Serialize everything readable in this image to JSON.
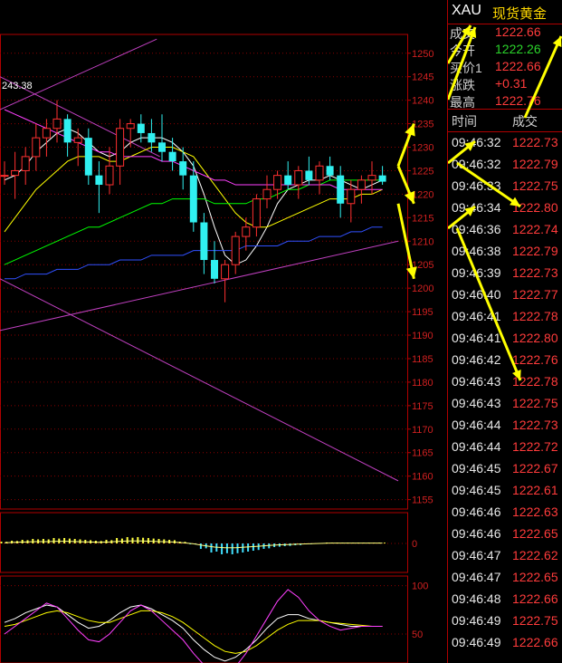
{
  "chart_data": [
    {
      "type": "candlestick",
      "price_labels": [
        "1250",
        "1245",
        "1240",
        "1235",
        "1230",
        "1225",
        "1220",
        "1215",
        "1210",
        "1205",
        "1200",
        "1195",
        "1190",
        "1185",
        "1180",
        "1175",
        "1170",
        "1165",
        "1160",
        "1155"
      ],
      "ylim": [
        1153,
        1254
      ],
      "annotation": "243.38",
      "ohlc": [
        [
          1224,
          1227,
          1222,
          1224
        ],
        [
          1224,
          1229,
          1219,
          1225
        ],
        [
          1225,
          1230,
          1222,
          1228
        ],
        [
          1228,
          1235,
          1225,
          1232
        ],
        [
          1232,
          1236,
          1228,
          1234
        ],
        [
          1234,
          1240,
          1231,
          1236
        ],
        [
          1236,
          1237,
          1228,
          1231
        ],
        [
          1231,
          1234,
          1226,
          1232
        ],
        [
          1232,
          1234,
          1222,
          1224
        ],
        [
          1224,
          1227,
          1216,
          1222
        ],
        [
          1222,
          1230,
          1220,
          1226
        ],
        [
          1226,
          1236,
          1222,
          1234
        ],
        [
          1234,
          1236,
          1230,
          1235
        ],
        [
          1235,
          1237,
          1231,
          1233
        ],
        [
          1233,
          1236,
          1229,
          1231
        ],
        [
          1231,
          1237,
          1227,
          1229
        ],
        [
          1229,
          1232,
          1225,
          1227
        ],
        [
          1227,
          1230,
          1221,
          1224
        ],
        [
          1224,
          1227,
          1212,
          1214
        ],
        [
          1214,
          1216,
          1203,
          1206
        ],
        [
          1206,
          1210,
          1201,
          1202
        ],
        [
          1202,
          1206,
          1197,
          1205
        ],
        [
          1205,
          1212,
          1203,
          1211
        ],
        [
          1211,
          1215,
          1208,
          1213
        ],
        [
          1213,
          1220,
          1211,
          1219
        ],
        [
          1219,
          1224,
          1217,
          1221
        ],
        [
          1221,
          1225,
          1219,
          1224
        ],
        [
          1224,
          1227,
          1221,
          1222
        ],
        [
          1222,
          1226,
          1219,
          1225
        ],
        [
          1225,
          1228,
          1222,
          1223
        ],
        [
          1223,
          1227,
          1220,
          1226
        ],
        [
          1226,
          1228,
          1223,
          1224
        ],
        [
          1224,
          1226,
          1215,
          1218
        ],
        [
          1218,
          1223,
          1214,
          1221
        ],
        [
          1221,
          1224,
          1218,
          1223
        ],
        [
          1223,
          1227,
          1220,
          1224
        ],
        [
          1224,
          1226,
          1222,
          1222.66
        ]
      ],
      "ma": [
        {
          "color": "#ffffff",
          "values": [
            1223,
            1224,
            1226,
            1229,
            1231,
            1233,
            1234,
            1233,
            1231,
            1229,
            1228,
            1229,
            1231,
            1232,
            1232,
            1232,
            1231,
            1229,
            1226,
            1220,
            1213,
            1207,
            1205,
            1206,
            1209,
            1213,
            1218,
            1221,
            1222,
            1223,
            1223,
            1224,
            1223,
            1222,
            1221,
            1222,
            1223
          ]
        },
        {
          "color": "#ffff00",
          "values": [
            1212,
            1215,
            1218,
            1221,
            1223,
            1225,
            1227,
            1228,
            1228,
            1228,
            1227,
            1227,
            1228,
            1229,
            1230,
            1230,
            1230,
            1229,
            1228,
            1225,
            1222,
            1219,
            1216,
            1214,
            1213,
            1213,
            1214,
            1215,
            1216,
            1217,
            1218,
            1219,
            1219,
            1219,
            1220,
            1220,
            1221
          ]
        },
        {
          "color": "#00ff00",
          "values": [
            1205,
            1206,
            1207,
            1208,
            1209,
            1210,
            1211,
            1212,
            1213,
            1213,
            1214,
            1215,
            1216,
            1217,
            1218,
            1218,
            1219,
            1219,
            1219,
            1219,
            1218,
            1218,
            1218,
            1218,
            1219,
            1219,
            1220,
            1221,
            1221,
            1222,
            1222,
            1223,
            1223,
            1223,
            1223,
            1223,
            1223
          ]
        },
        {
          "color": "#ff40ff",
          "values": [
            1238,
            1237,
            1236,
            1235,
            1234,
            1233,
            1232,
            1231,
            1230,
            1229,
            1229,
            1228,
            1228,
            1228,
            1228,
            1227,
            1227,
            1226,
            1225,
            1224,
            1223,
            1223,
            1222,
            1222,
            1222,
            1222,
            1222,
            1222,
            1222,
            1222,
            1222,
            1222,
            1221,
            1221,
            1221,
            1221,
            1221
          ]
        },
        {
          "color": "#3050ff",
          "values": [
            1202,
            1202,
            1203,
            1203,
            1203,
            1204,
            1204,
            1204,
            1205,
            1205,
            1205,
            1206,
            1206,
            1206,
            1207,
            1207,
            1207,
            1207,
            1208,
            1208,
            1208,
            1208,
            1208,
            1209,
            1209,
            1209,
            1209,
            1210,
            1210,
            1210,
            1211,
            1211,
            1211,
            1212,
            1212,
            1213,
            1213
          ]
        }
      ],
      "trendlines": [
        {
          "color": "#c040c0",
          "x": [
            0,
            14.5
          ],
          "y": [
            1238,
            1253
          ]
        },
        {
          "color": "#c040c0",
          "x": [
            0,
            14.8
          ],
          "y": [
            1245,
            1228
          ]
        },
        {
          "color": "#c040c0",
          "x": [
            0,
            37.5
          ],
          "y": [
            1191,
            1210
          ]
        },
        {
          "color": "#c040c0",
          "x": [
            0,
            37.5
          ],
          "y": [
            1202,
            1159
          ]
        }
      ],
      "arrows": [
        {
          "x1": 37.5,
          "y1": 1226,
          "x2": 39.0,
          "y2": 1235
        },
        {
          "x1": 37.5,
          "y1": 1226,
          "x2": 39.0,
          "y2": 1218
        },
        {
          "x1": 37.5,
          "y1": 1218,
          "x2": 39.0,
          "y2": 1202
        }
      ]
    },
    {
      "type": "histogram",
      "label": "0",
      "values": [
        0.2,
        0.3,
        0.4,
        0.5,
        0.5,
        0.6,
        0.6,
        0.5,
        0.4,
        0.3,
        0.4,
        0.6,
        0.7,
        0.7,
        0.6,
        0.5,
        0.4,
        0.2,
        -0.1,
        -0.6,
        -1.0,
        -1.2,
        -1.2,
        -1.0,
        -0.8,
        -0.6,
        -0.4,
        -0.3,
        -0.2,
        -0.1,
        0.0,
        0.1,
        0.1,
        0.1,
        0.1,
        0.1,
        0.1
      ]
    },
    {
      "type": "line",
      "labels": [
        "100",
        "50"
      ],
      "ylim": [
        20,
        110
      ],
      "series": [
        {
          "color": "#ffffff",
          "values": [
            62,
            66,
            72,
            76,
            80,
            78,
            70,
            62,
            56,
            58,
            64,
            72,
            78,
            80,
            76,
            70,
            64,
            56,
            44,
            34,
            26,
            22,
            26,
            34,
            44,
            56,
            66,
            70,
            70,
            66,
            64,
            62,
            60,
            58,
            58,
            58,
            58
          ]
        },
        {
          "color": "#ffff00",
          "values": [
            58,
            60,
            64,
            68,
            72,
            74,
            72,
            68,
            64,
            62,
            62,
            66,
            70,
            74,
            74,
            72,
            68,
            62,
            54,
            46,
            38,
            32,
            30,
            32,
            38,
            46,
            54,
            60,
            64,
            64,
            64,
            62,
            61,
            60,
            59,
            58,
            58
          ]
        },
        {
          "color": "#ff40ff",
          "values": [
            50,
            58,
            66,
            74,
            82,
            78,
            66,
            54,
            44,
            42,
            50,
            62,
            74,
            80,
            74,
            64,
            54,
            44,
            30,
            18,
            10,
            8,
            16,
            30,
            48,
            66,
            84,
            96,
            88,
            74,
            64,
            58,
            54,
            56,
            58,
            58,
            58
          ]
        }
      ]
    }
  ],
  "panel": {
    "symbol": "XAU",
    "name": "现货黄金",
    "quote_rows": [
      {
        "label": "成交",
        "value": "1222.66",
        "color": "red"
      },
      {
        "label": "今开",
        "value": "1222.26",
        "color": "grn"
      },
      {
        "label": "买价1",
        "value": "1222.66",
        "color": "red"
      },
      {
        "label": "涨跌",
        "value": "+0.31",
        "color": "red"
      },
      {
        "label": "最高",
        "value": "1222.76",
        "color": "red"
      }
    ],
    "col_time": "时间",
    "col_price": "成交",
    "ticks": [
      {
        "time": "09:46:32",
        "price": "1222.73"
      },
      {
        "time": "09:46:32",
        "price": "1222.79"
      },
      {
        "time": "09:46:33",
        "price": "1222.75"
      },
      {
        "time": "09:46:34",
        "price": "1222.80"
      },
      {
        "time": "09:46:36",
        "price": "1222.74"
      },
      {
        "time": "09:46:38",
        "price": "1222.79"
      },
      {
        "time": "09:46:39",
        "price": "1222.73"
      },
      {
        "time": "09:46:40",
        "price": "1222.77"
      },
      {
        "time": "09:46:41",
        "price": "1222.78"
      },
      {
        "time": "09:46:41",
        "price": "1222.80"
      },
      {
        "time": "09:46:42",
        "price": "1222.76"
      },
      {
        "time": "09:46:43",
        "price": "1222.78"
      },
      {
        "time": "09:46:43",
        "price": "1222.75"
      },
      {
        "time": "09:46:44",
        "price": "1222.73"
      },
      {
        "time": "09:46:44",
        "price": "1222.72"
      },
      {
        "time": "09:46:45",
        "price": "1222.67"
      },
      {
        "time": "09:46:45",
        "price": "1222.61"
      },
      {
        "time": "09:46:46",
        "price": "1222.63"
      },
      {
        "time": "09:46:46",
        "price": "1222.65"
      },
      {
        "time": "09:46:47",
        "price": "1222.62"
      },
      {
        "time": "09:46:47",
        "price": "1222.65"
      },
      {
        "time": "09:46:48",
        "price": "1222.66"
      },
      {
        "time": "09:46:49",
        "price": "1222.75"
      },
      {
        "time": "09:46:49",
        "price": "1222.66"
      }
    ],
    "panel_arrows": [
      {
        "r1": 0,
        "r2": 1,
        "dir": "up"
      },
      {
        "r1": 1,
        "r2": 3,
        "dir": "down"
      },
      {
        "r1": 3,
        "r2": 4,
        "dir": "up"
      },
      {
        "r1": 4,
        "r2": 11,
        "dir": "down"
      }
    ]
  }
}
